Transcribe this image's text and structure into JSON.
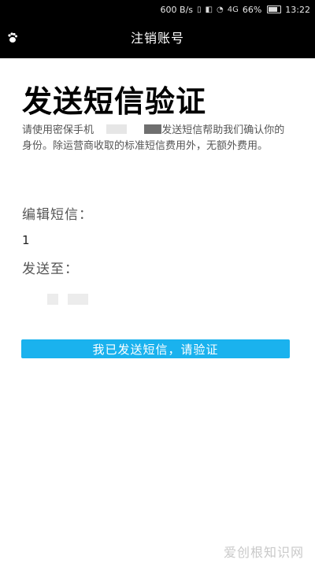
{
  "status_bar": {
    "speed": "600 B/s",
    "signal": "4G",
    "battery": "66%",
    "time": "13:22"
  },
  "app_bar": {
    "title": "注销账号",
    "left_icon": "baidu-paw-icon"
  },
  "main": {
    "heading": "发送短信验证",
    "description_prefix": "请使用密保手机",
    "description_suffix": "发送短信帮助我们确认你的身份。除运营商收取的标准短信费用外，无额外费用。",
    "sms_label": "编辑短信：",
    "sms_content": "1",
    "send_to_label": "发送至：",
    "confirm_button": "我已发送短信，请验证"
  },
  "watermark": "爱创根知识网",
  "colors": {
    "accent": "#1ab2ee",
    "bar_background": "#000000"
  }
}
